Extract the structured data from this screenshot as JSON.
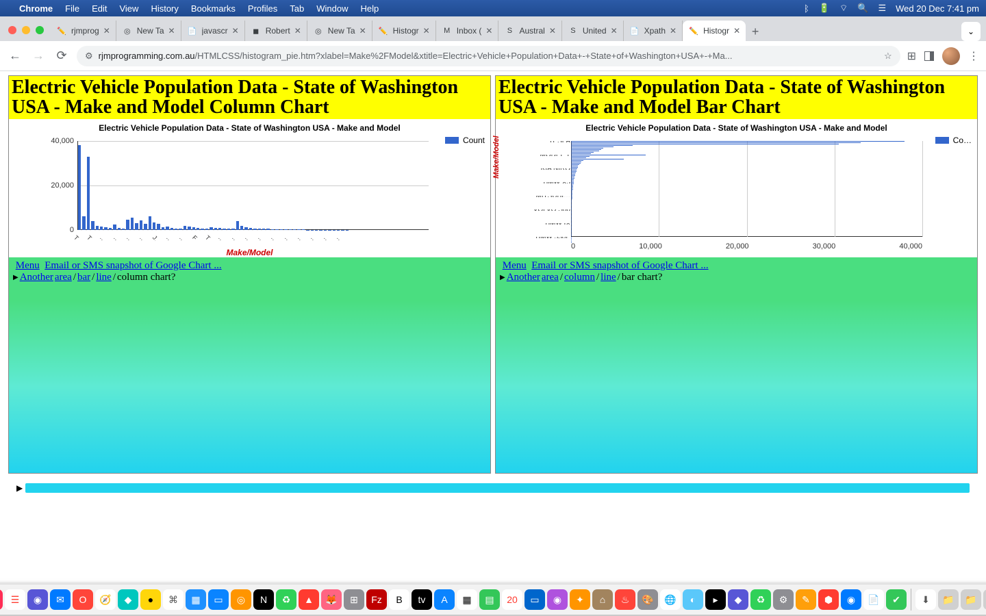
{
  "menubar": {
    "app": "Chrome",
    "items": [
      "File",
      "Edit",
      "View",
      "History",
      "Bookmarks",
      "Profiles",
      "Tab",
      "Window",
      "Help"
    ],
    "clock": "Wed 20 Dec  7:41 pm"
  },
  "tabs": [
    {
      "title": "rjmprog",
      "fav": "✏️"
    },
    {
      "title": "New Ta",
      "fav": "◎"
    },
    {
      "title": "javascr",
      "fav": "📄"
    },
    {
      "title": "Robert",
      "fav": "◼"
    },
    {
      "title": "New Ta",
      "fav": "◎"
    },
    {
      "title": "Histogr",
      "fav": "✏️"
    },
    {
      "title": "Inbox (",
      "fav": "M"
    },
    {
      "title": "Austral",
      "fav": "S"
    },
    {
      "title": "United",
      "fav": "S"
    },
    {
      "title": "Xpath",
      "fav": "📄"
    },
    {
      "title": "Histogr",
      "fav": "✏️",
      "active": true
    }
  ],
  "address": {
    "host": "rjmprogramming.com.au",
    "path": "/HTMLCSS/histogram_pie.htm?xlabel=Make%2FModel&xtitle=Electric+Vehicle+Population+Data+-+State+of+Washington+USA+-+Ma..."
  },
  "left_panel": {
    "heading": "Electric Vehicle Population Data - State of Washington USA - Make and Model Column Chart",
    "chart_title": "Electric Vehicle Population Data - State of Washington USA - Make and Model",
    "xlabel": "Make/Model",
    "legend": "Count",
    "menu": "Menu",
    "email": "Email or SMS snapshot of Google Chart ...",
    "another": "Another ",
    "links": {
      "area": "area",
      "bar": "bar",
      "line": "line",
      "column": "column chart?"
    }
  },
  "right_panel": {
    "heading": "Electric Vehicle Population Data - State of Washington USA - Make and Model Bar Chart",
    "chart_title": "Electric Vehicle Population Data - State of Washington USA - Make and Model",
    "ylabel": "Make/Model",
    "legend": "Co…",
    "menu": "Menu",
    "email": "Email or SMS snapshot of Google Chart ...",
    "another": "Another ",
    "links": {
      "area": "area",
      "column": "column",
      "line": "line",
      "bar": "bar chart?"
    }
  },
  "chart_data": [
    {
      "type": "bar",
      "orientation": "vertical",
      "title": "Electric Vehicle Population Data - State of Washington USA - Make and Model",
      "xlabel": "Make/Model",
      "ylabel": "",
      "ylim": [
        0,
        40000
      ],
      "yticks": [
        0,
        20000,
        40000
      ],
      "legend": [
        "Count"
      ],
      "categories_shown": [
        "T…",
        "T…",
        "…",
        "…",
        "…",
        "…",
        "J…",
        "…",
        "…",
        "F…",
        "T…",
        "…",
        "…",
        "…",
        "…",
        "…",
        "…",
        "…",
        "…",
        "…",
        "…"
      ],
      "values": [
        38000,
        6000,
        33000,
        4000,
        1800,
        1500,
        1200,
        1000,
        2400,
        800,
        700,
        4500,
        5500,
        3000,
        4200,
        2800,
        6200,
        3300,
        2700,
        1200,
        1400,
        800,
        600,
        500,
        1900,
        1600,
        1300,
        900,
        700,
        500,
        1100,
        900,
        800,
        600,
        500,
        400,
        3800,
        1700,
        1200,
        900,
        700,
        600,
        500,
        400,
        300,
        250,
        200,
        180,
        160,
        140,
        120,
        100,
        90,
        80,
        70,
        60,
        50,
        45,
        40,
        35,
        30,
        25,
        20,
        18,
        16,
        14,
        12,
        10,
        9,
        8,
        7,
        6,
        5,
        4,
        3,
        2,
        2,
        2,
        1,
        1
      ]
    },
    {
      "type": "bar",
      "orientation": "horizontal",
      "title": "Electric Vehicle Population Data - State of Washington USA - Make and Model",
      "xlabel": "",
      "ylabel": "Make/Model",
      "xlim": [
        0,
        40000
      ],
      "xticks": [
        0,
        10000,
        20000,
        30000,
        40000
      ],
      "legend": [
        "Count"
      ],
      "categories_shown": [
        "TESLA",
        "MODEL Y",
        "KIA NIRO",
        "BMW X5",
        "MITSUBI…",
        "VOLVO S60",
        "BMW IX",
        "BMW 530E"
      ],
      "series": [
        {
          "name": "Count",
          "values": [
            38000,
            33000,
            30500,
            7000,
            4800,
            3700,
            3400,
            3200,
            2600,
            2300,
            8500,
            2100,
            1700,
            6000,
            1400,
            1200,
            1100,
            900,
            800,
            760,
            700,
            650,
            600,
            550,
            500,
            460,
            420,
            380,
            340,
            320,
            300,
            280,
            260,
            240,
            220,
            200,
            180,
            170,
            160,
            150,
            140,
            130,
            120,
            110,
            100,
            95,
            90,
            85,
            80,
            75,
            70,
            65,
            60,
            55,
            50,
            45,
            40,
            38,
            36,
            34,
            32,
            30,
            28,
            26,
            24,
            22,
            20,
            18,
            16,
            14,
            12,
            10,
            9,
            8,
            7,
            6,
            5,
            4,
            3,
            2
          ]
        }
      ]
    }
  ]
}
